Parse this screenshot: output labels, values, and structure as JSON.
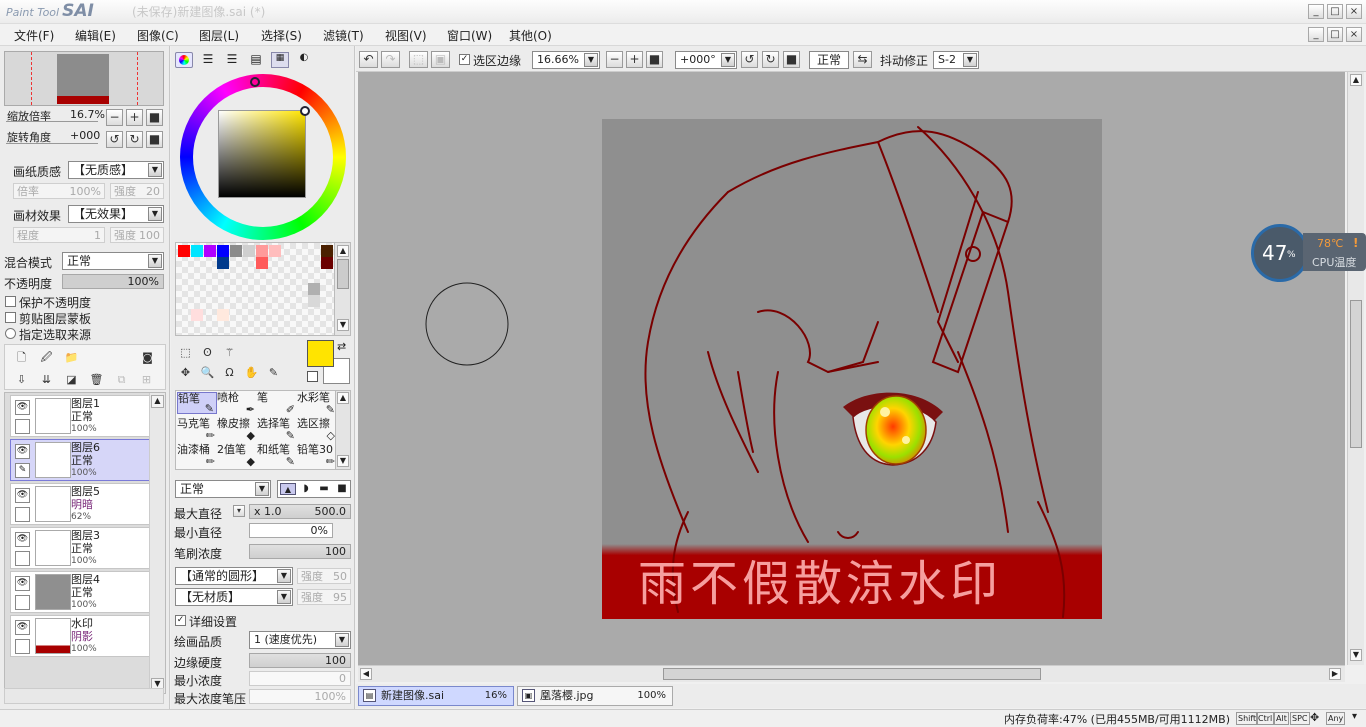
{
  "window": {
    "app_logo_small": "Paint Tool",
    "app_logo_big": "SAI",
    "title": "(未保存)新建图像.sai (*)",
    "controls": [
      "_",
      "□",
      "×"
    ]
  },
  "menu": [
    "文件(F)",
    "编辑(E)",
    "图像(C)",
    "图层(L)",
    "选择(S)",
    "滤镜(T)",
    "视图(V)",
    "窗口(W)",
    "其他(O)"
  ],
  "navigator": {
    "zoom_label": "缩放倍率",
    "zoom_value": "16.7%",
    "rotate_label": "旋转角度",
    "rotate_value": "+000"
  },
  "paper": {
    "texture_label": "画纸质感",
    "texture_value": "【无质感】",
    "rate_label": "倍率",
    "rate_value": "100%",
    "strength_label": "强度",
    "strength_value": "20",
    "effect_label": "画材效果",
    "effect_value": "【无效果】",
    "degree_label": "程度",
    "degree_value": "1",
    "strength2_label": "强度",
    "strength2_value": "100"
  },
  "layer_props": {
    "blend_label": "混合模式",
    "blend_value": "正常",
    "opacity_label": "不透明度",
    "opacity_value": "100%",
    "opacity_fraction": 1.0,
    "protect_opacity": "保护不透明度",
    "clip_mask": "剪贴图层蒙板",
    "selection_source": "指定选取来源"
  },
  "layers": [
    {
      "name": "图层1",
      "mode": "正常",
      "opacity": "100%",
      "selected": false,
      "mode_color": "#222"
    },
    {
      "name": "图层6",
      "mode": "正常",
      "opacity": "100%",
      "selected": true,
      "mode_color": "#222"
    },
    {
      "name": "图层5",
      "mode": "明暗",
      "opacity": "62%",
      "selected": false,
      "mode_color": "#7a2a7a"
    },
    {
      "name": "图层3",
      "mode": "正常",
      "opacity": "100%",
      "selected": false,
      "mode_color": "#222"
    },
    {
      "name": "图层4",
      "mode": "正常",
      "opacity": "100%",
      "selected": false,
      "mode_color": "#222"
    },
    {
      "name": "水印",
      "mode": "阴影",
      "opacity": "100%",
      "selected": false,
      "mode_color": "#7a2a7a"
    }
  ],
  "colors": {
    "primary": "#ffe400",
    "secondary": "#ffffff",
    "swatches": [
      "#ff0000",
      "#00e5ff",
      "#b000ff",
      "#0000ff",
      "#8a8a8a",
      "#cfcfcf",
      "#ff9a9a",
      "#ffbdbd",
      "#4a2000",
      "#003a8c",
      "#ff5a5a",
      "#6b0000",
      "#b0b0b0",
      "#d8d8d8",
      "#ffdede",
      "#ffe9de"
    ]
  },
  "brushes": [
    "铅笔",
    "喷枪",
    "笔",
    "水彩笔",
    "马克笔",
    "橡皮擦",
    "选择笔",
    "选区擦",
    "油漆桶",
    "2值笔",
    "和纸笔",
    "铅笔30"
  ],
  "brush_settings": {
    "mode": "正常",
    "max_diameter_label": "最大直径",
    "max_mult": "x 1.0",
    "max_value": "500.0",
    "min_diameter_label": "最小直径",
    "min_value": "0%",
    "density_label": "笔刷浓度",
    "density_value": "100",
    "shape_value": "【通常的圆形】",
    "shape_strength_label": "强度",
    "shape_strength_value": "50",
    "texture_value": "【无材质】",
    "texture_strength_label": "强度",
    "texture_strength_value": "95",
    "detail_label": "详细设置",
    "quality_label": "绘画品质",
    "quality_value": "1 (速度优先)",
    "edge_label": "边缘硬度",
    "edge_value": "100",
    "min_density_label": "最小浓度",
    "min_density_value": "0",
    "max_pressure_label": "最大浓度笔压",
    "max_pressure_value": "100%"
  },
  "toolbar": {
    "selection_edge": "选区边缘",
    "zoom": "16.66%",
    "angle": "+000°",
    "mode": "正常",
    "stabilizer_label": "抖动修正",
    "stabilizer_value": "S-2"
  },
  "canvas": {
    "watermark": "雨不假散涼水印"
  },
  "tabs": [
    {
      "name": "新建图像.sai",
      "zoom": "16%"
    },
    {
      "name": "凰落樱.jpg",
      "zoom": "100%"
    }
  ],
  "status": {
    "memory": "内存负荷率:47% (已用455MB/可用1112MB)",
    "keys": [
      "Shift",
      "Ctrl",
      "Alt",
      "SPC",
      "Any"
    ]
  },
  "cpu_widget": {
    "percent": "47",
    "percent_unit": "%",
    "temp": "78℃",
    "label": "CPU温度"
  }
}
